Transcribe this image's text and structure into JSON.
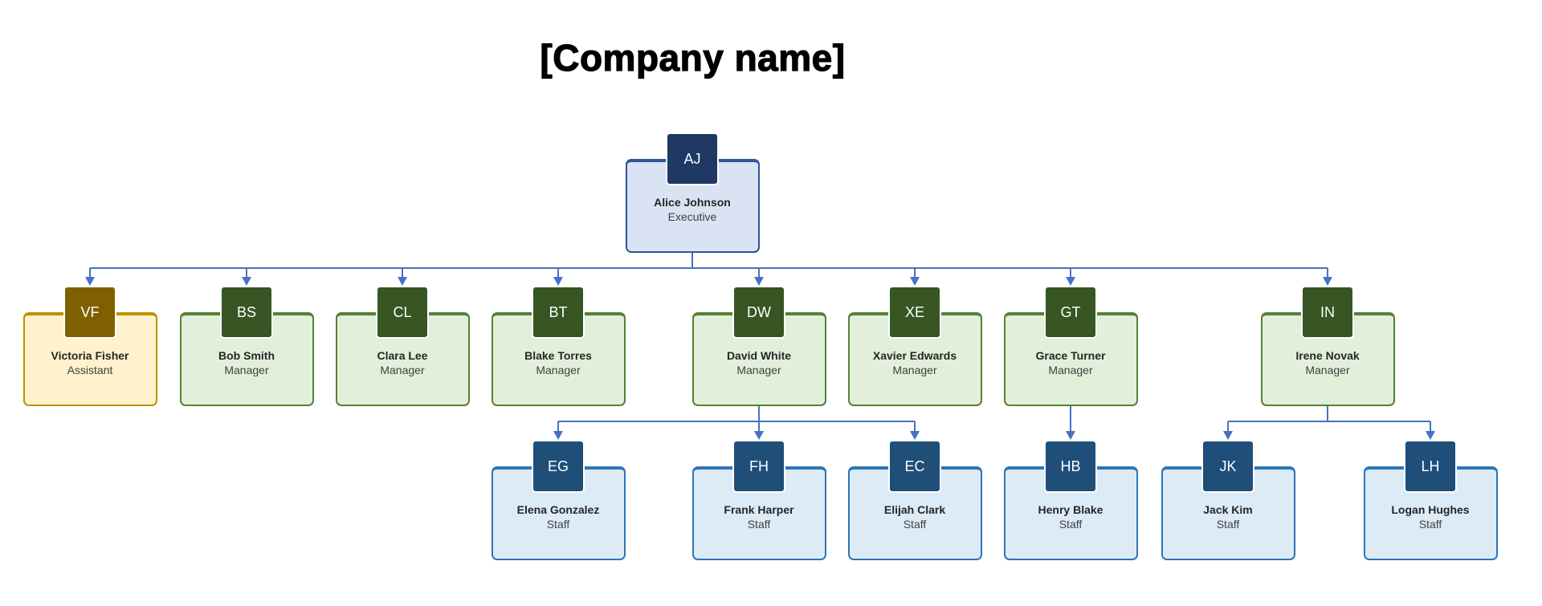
{
  "title": "[Company name]",
  "colors": {
    "connector": "#4472c4",
    "executive": {
      "avatar": "#1f3864",
      "fill": "#dae3f3",
      "border": "#2f5597"
    },
    "manager": {
      "avatar": "#375623",
      "fill": "#e2efda",
      "border": "#548235"
    },
    "assistant": {
      "avatar": "#7f6000",
      "fill": "#fff2cc",
      "border": "#bf9000"
    },
    "staff": {
      "avatar": "#1f4e79",
      "fill": "#ddebf7",
      "border": "#2e75b6"
    }
  },
  "nodes": [
    {
      "id": "aj",
      "initials": "AJ",
      "name": "Alice Johnson",
      "role": "Executive",
      "type": "executive",
      "parent": null
    },
    {
      "id": "vf",
      "initials": "VF",
      "name": "Victoria Fisher",
      "role": "Assistant",
      "type": "assistant",
      "parent": "aj"
    },
    {
      "id": "bs",
      "initials": "BS",
      "name": "Bob Smith",
      "role": "Manager",
      "type": "manager",
      "parent": "aj"
    },
    {
      "id": "cl",
      "initials": "CL",
      "name": "Clara Lee",
      "role": "Manager",
      "type": "manager",
      "parent": "aj"
    },
    {
      "id": "bt",
      "initials": "BT",
      "name": "Blake Torres",
      "role": "Manager",
      "type": "manager",
      "parent": "aj"
    },
    {
      "id": "dw",
      "initials": "DW",
      "name": "David White",
      "role": "Manager",
      "type": "manager",
      "parent": "aj"
    },
    {
      "id": "xe",
      "initials": "XE",
      "name": "Xavier Edwards",
      "role": "Manager",
      "type": "manager",
      "parent": "aj"
    },
    {
      "id": "gt",
      "initials": "GT",
      "name": "Grace Turner",
      "role": "Manager",
      "type": "manager",
      "parent": "aj"
    },
    {
      "id": "in",
      "initials": "IN",
      "name": "Irene Novak",
      "role": "Manager",
      "type": "manager",
      "parent": "aj"
    },
    {
      "id": "eg",
      "initials": "EG",
      "name": "Elena Gonzalez",
      "role": "Staff",
      "type": "staff",
      "parent": "dw"
    },
    {
      "id": "fh",
      "initials": "FH",
      "name": "Frank Harper",
      "role": "Staff",
      "type": "staff",
      "parent": "dw"
    },
    {
      "id": "ec",
      "initials": "EC",
      "name": "Elijah Clark",
      "role": "Staff",
      "type": "staff",
      "parent": "dw"
    },
    {
      "id": "hb",
      "initials": "HB",
      "name": "Henry Blake",
      "role": "Staff",
      "type": "staff",
      "parent": "gt"
    },
    {
      "id": "jk",
      "initials": "JK",
      "name": "Jack Kim",
      "role": "Staff",
      "type": "staff",
      "parent": "in"
    },
    {
      "id": "lh",
      "initials": "LH",
      "name": "Logan Hughes",
      "role": "Staff",
      "type": "staff",
      "parent": "in"
    }
  ]
}
